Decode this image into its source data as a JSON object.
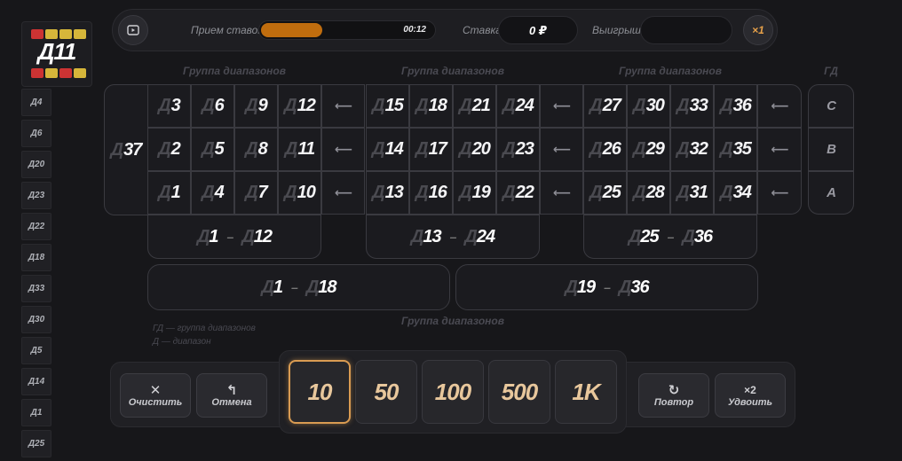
{
  "history": {
    "latest": "Д11",
    "items": [
      "Д4",
      "Д6",
      "Д20",
      "Д23",
      "Д22",
      "Д18",
      "Д33",
      "Д30",
      "Д5",
      "Д14",
      "Д1",
      "Д25"
    ]
  },
  "topbar": {
    "status_label": "Прием ставок",
    "timer": "00:12",
    "timer_progress": 0.35,
    "bet_label": "Ставка",
    "bet_value": "0 ₽",
    "win_label": "Выигрыш",
    "win_value": "",
    "multiplier": "×1"
  },
  "table": {
    "group_header": "Группа диапазонов",
    "gd_header": "ГД",
    "zero": "37",
    "prefix": "Д",
    "row_c": [
      "3",
      "6",
      "9",
      "12",
      "15",
      "18",
      "21",
      "24",
      "27",
      "30",
      "33",
      "36"
    ],
    "row_b": [
      "2",
      "5",
      "8",
      "11",
      "14",
      "17",
      "20",
      "23",
      "26",
      "29",
      "32",
      "35"
    ],
    "row_a": [
      "1",
      "4",
      "7",
      "10",
      "13",
      "16",
      "19",
      "22",
      "25",
      "28",
      "31",
      "34"
    ],
    "gd_labels": [
      "C",
      "B",
      "A"
    ],
    "dozens": [
      {
        "from": "1",
        "to": "12"
      },
      {
        "from": "13",
        "to": "24"
      },
      {
        "from": "25",
        "to": "36"
      }
    ],
    "halves": [
      {
        "from": "1",
        "to": "18"
      },
      {
        "from": "19",
        "to": "36"
      }
    ],
    "dash": "–",
    "bottom_header": "Группа диапазонов",
    "legend_gd": "ГД — группа диапазонов",
    "legend_d": "Д — диапазон"
  },
  "controls": {
    "clear": "Очистить",
    "undo": "Отмена",
    "repeat": "Повтор",
    "double": "Удвоить",
    "double_icon": "×2",
    "chips": [
      "10",
      "50",
      "100",
      "500",
      "1K"
    ],
    "selected_chip": "10"
  },
  "colors": {
    "accent": "#d99b52",
    "progress": "#c06d0e",
    "background": "#17171a"
  }
}
